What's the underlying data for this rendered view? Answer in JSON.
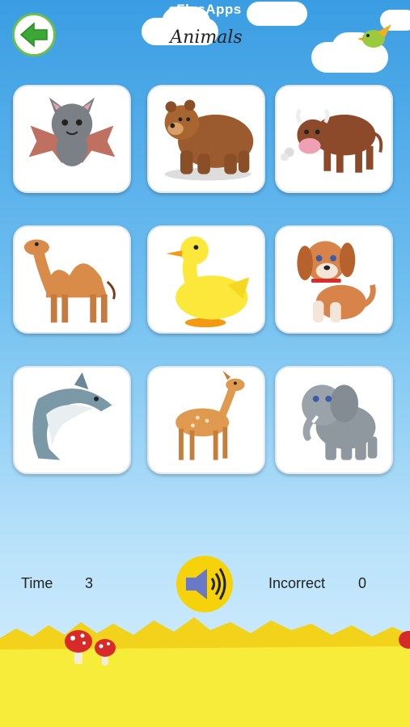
{
  "app": {
    "title": "eFlasApps"
  },
  "header": {
    "title": "Animals"
  },
  "cards": [
    {
      "animal": "bat"
    },
    {
      "animal": "bear"
    },
    {
      "animal": "bull"
    },
    {
      "animal": "camel"
    },
    {
      "animal": "duck"
    },
    {
      "animal": "dog"
    },
    {
      "animal": "dolphin"
    },
    {
      "animal": "deer"
    },
    {
      "animal": "elephant"
    }
  ],
  "stats": {
    "time_label": "Time",
    "time_value": "3",
    "incorrect_label": "Incorrect",
    "incorrect_value": "0"
  },
  "icons": {
    "back": "arrow-left-icon",
    "sound": "speaker-icon",
    "bird": "bird-icon",
    "mushroom": "mushroom-icon"
  },
  "colors": {
    "sky_top": "#3a9de3",
    "sky_bottom": "#d9f0ff",
    "back_arrow": "#3aa832",
    "sound_button": "#f6d20a",
    "speaker": "#6a78c8",
    "grass": "#f6e21a"
  }
}
